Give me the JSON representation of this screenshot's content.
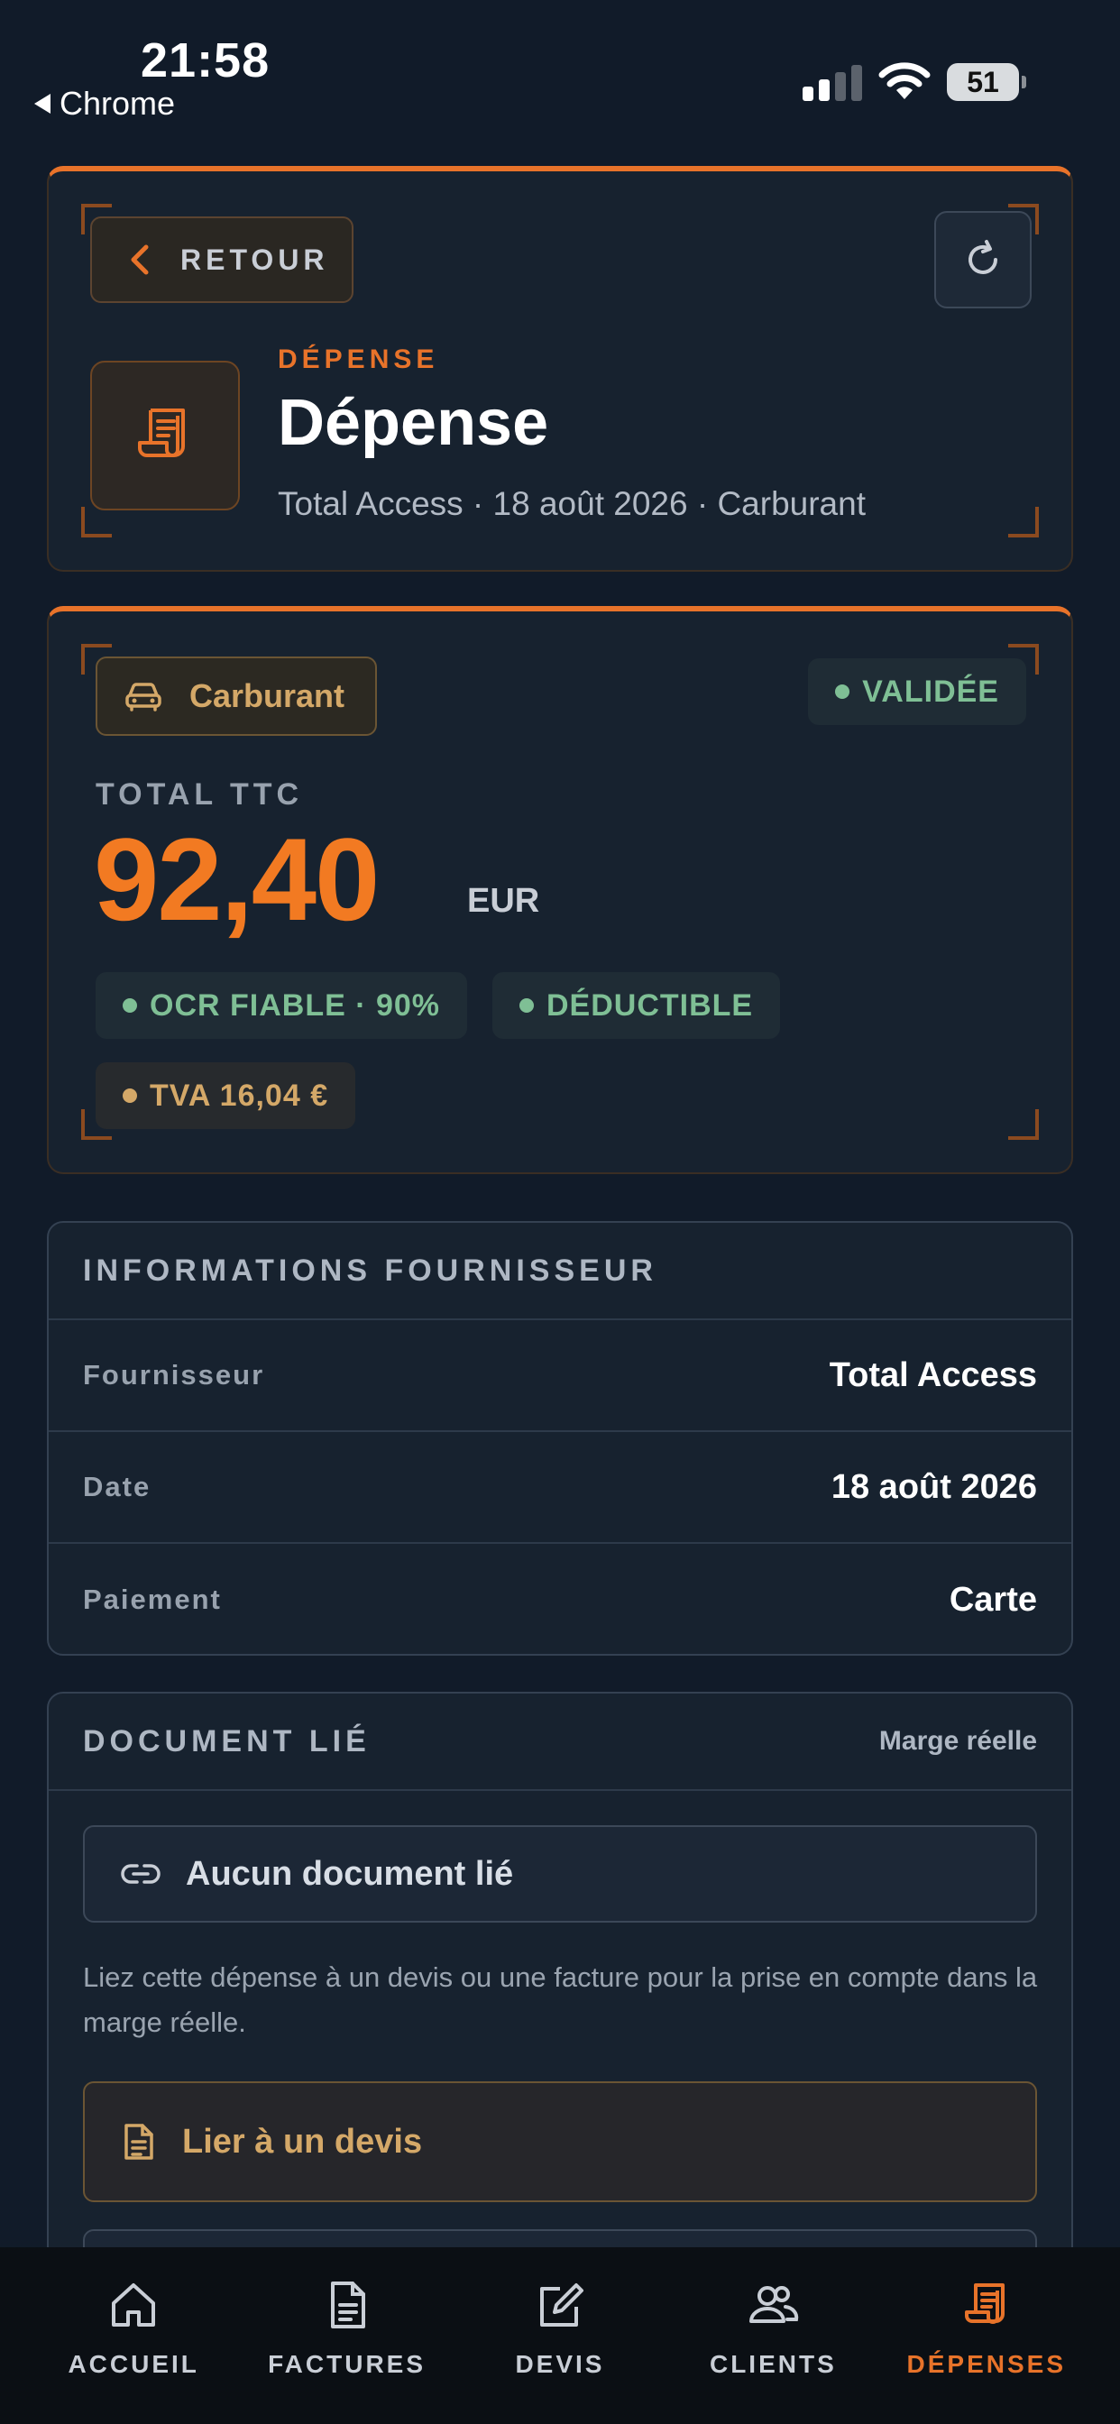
{
  "status_bar": {
    "time": "21:58",
    "back_app": "Chrome",
    "battery": "51"
  },
  "header": {
    "back_label": "RETOUR",
    "kicker": "DÉPENSE",
    "title": "Dépense",
    "subtitle": "Total Access · 18 août 2026 · Carburant",
    "icons": {
      "back": "chevron-left-icon",
      "refresh": "refresh-icon",
      "document": "receipt-icon"
    }
  },
  "summary": {
    "category": "Carburant",
    "category_icon": "car-icon",
    "status": "VALIDÉE",
    "total_label": "TOTAL TTC",
    "amount": "92,40",
    "currency": "EUR",
    "tags": {
      "ocr": "OCR FIABLE · 90%",
      "deductible": "DÉDUCTIBLE",
      "tva": "TVA 16,04 €"
    }
  },
  "supplier_info": {
    "title": "INFORMATIONS FOURNISSEUR",
    "rows": [
      {
        "label": "Fournisseur",
        "value": "Total Access"
      },
      {
        "label": "Date",
        "value": "18 août 2026"
      },
      {
        "label": "Paiement",
        "value": "Carte"
      }
    ]
  },
  "linked_document": {
    "title": "DOCUMENT LIÉ",
    "aside": "Marge réelle",
    "empty_label": "Aucun document lié",
    "hint": "Liez cette dépense à un devis ou une facture pour la prise en compte dans la marge réelle.",
    "link_devis_label": "Lier à un devis"
  },
  "bottom_nav": {
    "items": [
      {
        "label": "ACCUEIL",
        "icon": "home-icon"
      },
      {
        "label": "FACTURES",
        "icon": "invoice-icon"
      },
      {
        "label": "DEVIS",
        "icon": "edit-icon"
      },
      {
        "label": "CLIENTS",
        "icon": "users-icon"
      },
      {
        "label": "DÉPENSES",
        "icon": "receipt-icon"
      }
    ],
    "active": "DÉPENSES"
  },
  "colors": {
    "accent": "#e8732a",
    "success": "#7fbf95",
    "gold": "#d4a868",
    "background": "#111b29"
  }
}
